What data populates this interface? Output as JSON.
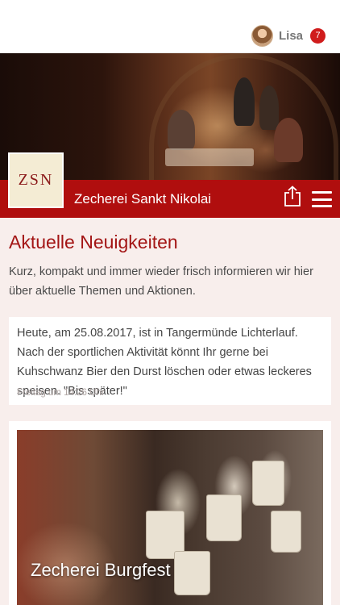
{
  "user": {
    "name": "Lisa",
    "notifications": "7",
    "avatar_icon": "user-avatar"
  },
  "brand": {
    "title": "Zecherei Sankt Nikolai",
    "logo_text": "ZSN",
    "bar_color": "#b00e0e",
    "share_icon": "share-icon",
    "menu_icon": "hamburger-menu-icon"
  },
  "news": {
    "heading": "Aktuelle Neuigkeiten",
    "description": "Kurz, kompakt und immer wieder frisch informieren wir hier über aktuelle Themen und Aktionen.",
    "items": [
      {
        "text": "Heute, am 25.08.2017, ist in Tangermünde Lichterlauf. Nach der sportlichen Aktivität könnt Ihr gerne bei Kuhschwanz Bier den Durst löschen oder etwas leckeres speisen. \"Bis später!\"",
        "time": "Freitag um 14:26 Uhr"
      }
    ]
  },
  "events": [
    {
      "title": "Zecherei Burgfest"
    }
  ]
}
